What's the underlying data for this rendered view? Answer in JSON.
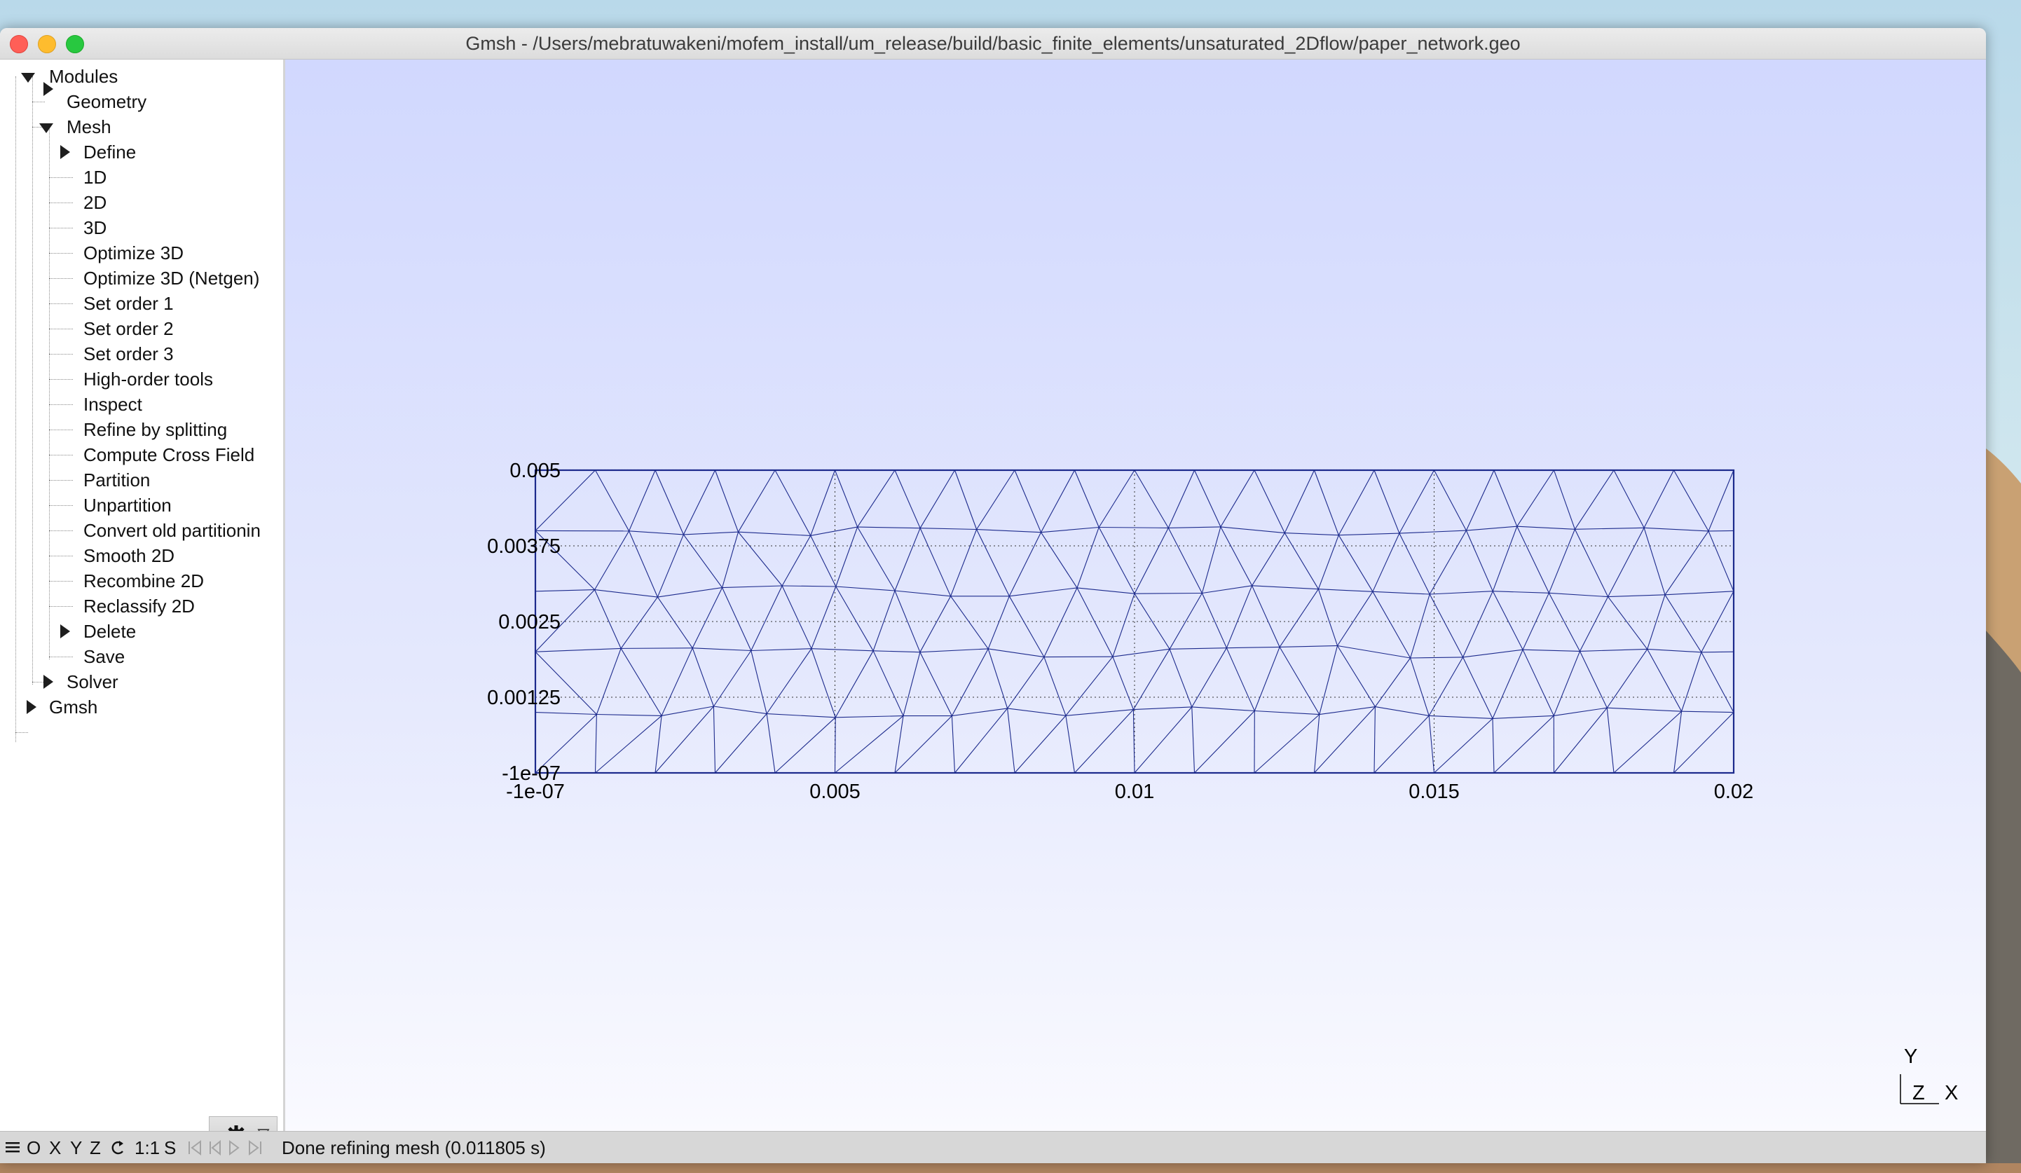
{
  "window": {
    "title": "Gmsh - /Users/mebratuwakeni/mofem_install/um_release/build/basic_finite_elements/unsaturated_2Dflow/paper_network.geo"
  },
  "tree": {
    "modules": "Modules",
    "geometry": "Geometry",
    "mesh": "Mesh",
    "mesh_items": [
      "Define",
      "1D",
      "2D",
      "3D",
      "Optimize 3D",
      "Optimize 3D (Netgen)",
      "Set order 1",
      "Set order 2",
      "Set order 3",
      "High-order tools",
      "Inspect",
      "Refine by splitting",
      "Compute Cross Field",
      "Partition",
      "Unpartition",
      "Convert old partitionin",
      "Smooth 2D",
      "Recombine 2D",
      "Reclassify 2D",
      "Delete",
      "Save"
    ],
    "solver": "Solver",
    "gmsh": "Gmsh"
  },
  "axes": {
    "x_ticks": [
      "-1e-07",
      "0.005",
      "0.01",
      "0.015",
      "0.02"
    ],
    "y_ticks": [
      "-1e-07",
      "0.00125",
      "0.0025",
      "0.00375",
      "0.005"
    ],
    "xlim": [
      0,
      0.02
    ],
    "ylim": [
      0,
      0.005
    ]
  },
  "triad": {
    "y": "Y",
    "z": "Z",
    "x": "X"
  },
  "statusbar": {
    "menu_icon": "hamburger-icon",
    "o": "O",
    "x": "X",
    "y": "Y",
    "z": "Z",
    "rotate_icon": "rotate-icon",
    "scale": "1:1",
    "s": "S",
    "message": "Done refining mesh (0.011805 s)"
  },
  "colors": {
    "mesh_line": "#1c2a8c",
    "viewport_top": "#d1d8fe",
    "viewport_bottom": "#fbfbff"
  }
}
